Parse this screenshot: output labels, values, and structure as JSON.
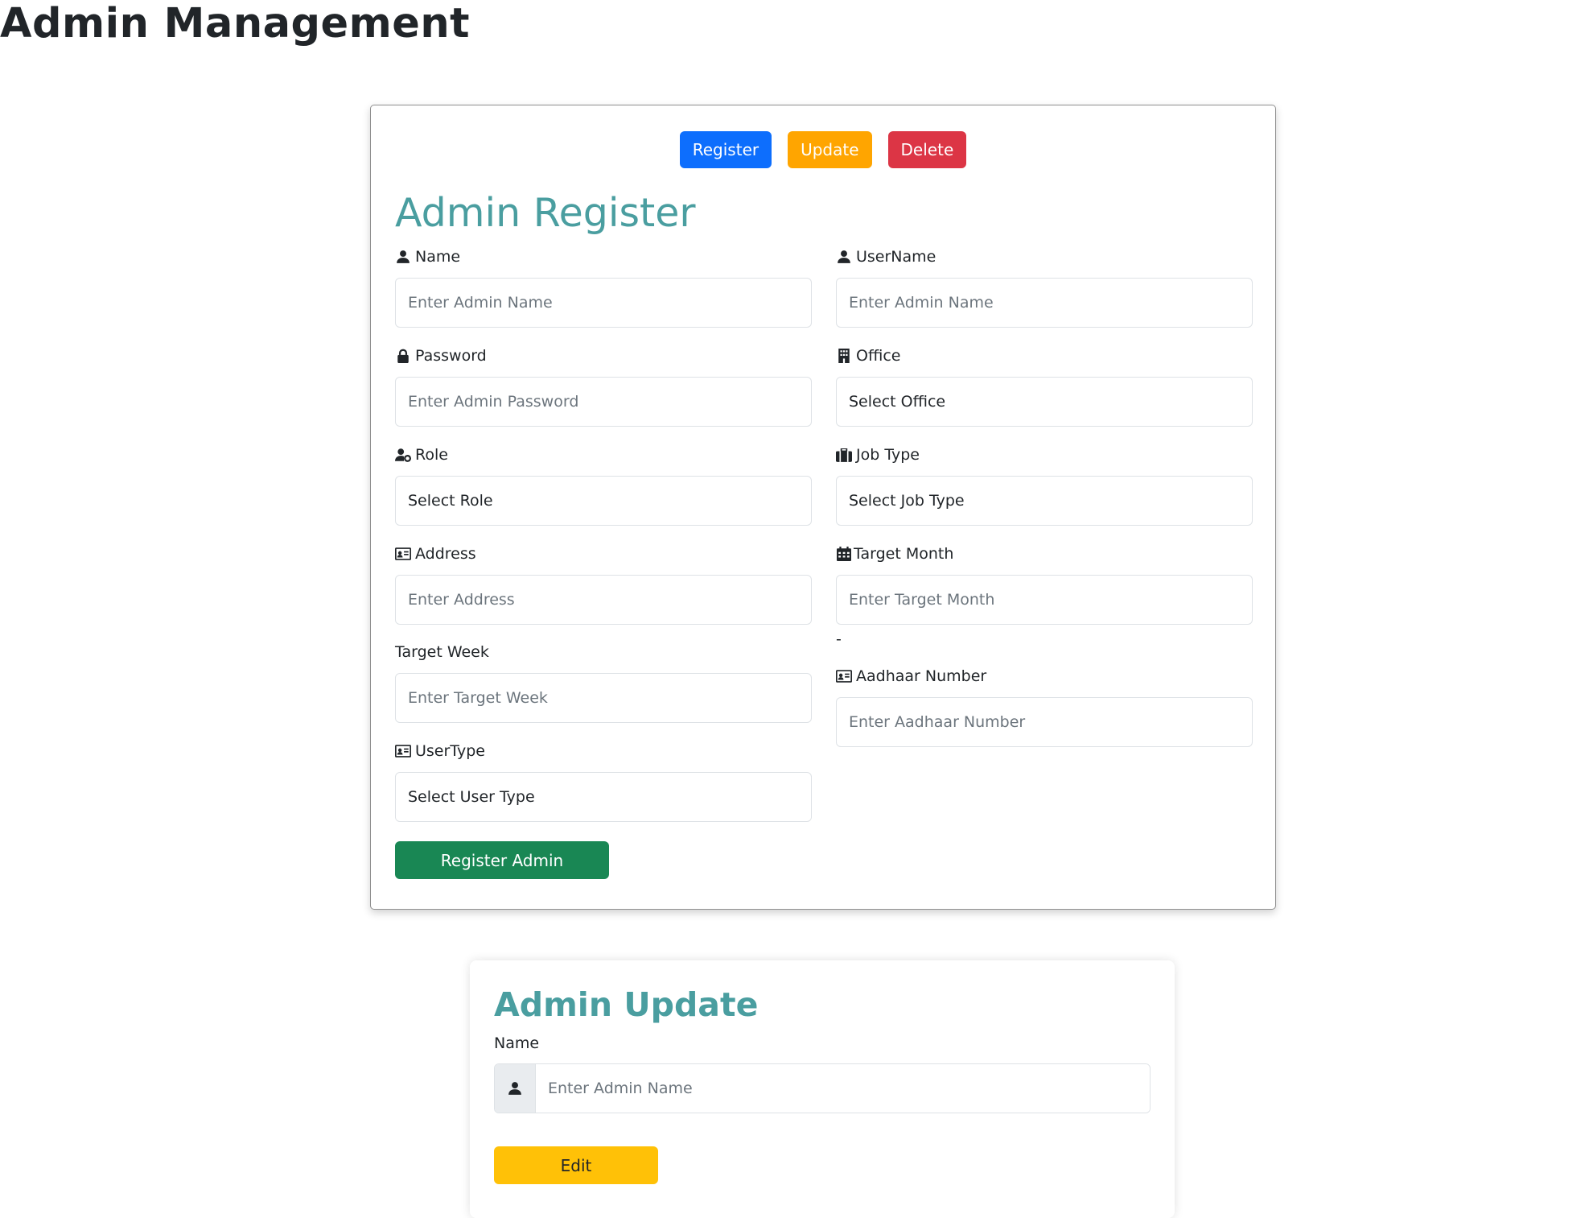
{
  "page": {
    "title": "Admin Management"
  },
  "tabs": {
    "register": "Register",
    "update": "Update",
    "delete": "Delete"
  },
  "register_form": {
    "title": "Admin Register",
    "name": {
      "label": "Name",
      "placeholder": "Enter Admin Name",
      "icon": "user-icon"
    },
    "username": {
      "label": "UserName",
      "placeholder": "Enter Admin Name",
      "icon": "user-icon"
    },
    "password": {
      "label": "Password",
      "placeholder": "Enter Admin Password",
      "icon": "lock-icon"
    },
    "office": {
      "label": "Office",
      "value": "Select Office",
      "icon": "building-icon"
    },
    "role": {
      "label": "Role",
      "value": "Select Role",
      "icon": "user-gear-icon"
    },
    "job_type": {
      "label": "Job Type",
      "value": "Select Job Type",
      "icon": "briefcase-icon"
    },
    "address": {
      "label": "Address",
      "placeholder": "Enter Address",
      "icon": "id-card-icon"
    },
    "target_month": {
      "label": "Target Month",
      "placeholder": "Enter Target Month",
      "icon": "calendar-icon"
    },
    "target_week": {
      "label": "Target Week",
      "placeholder": "Enter Target Week"
    },
    "dash": "-",
    "aadhaar": {
      "label": "Aadhaar Number",
      "placeholder": "Enter Aadhaar Number",
      "icon": "id-card-icon"
    },
    "user_type": {
      "label": "UserType",
      "value": "Select User Type",
      "icon": "id-card-icon"
    },
    "submit_label": "Register Admin"
  },
  "update_form": {
    "title": "Admin Update",
    "name": {
      "label": "Name",
      "placeholder": "Enter Admin Name",
      "icon": "user-icon"
    },
    "edit_label": "Edit"
  },
  "colors": {
    "primary": "#0d6efd",
    "warning_orange": "#ffa500",
    "danger": "#dc3545",
    "success": "#198754",
    "yellow": "#ffc107",
    "title_teal": "#4a9ea0"
  }
}
